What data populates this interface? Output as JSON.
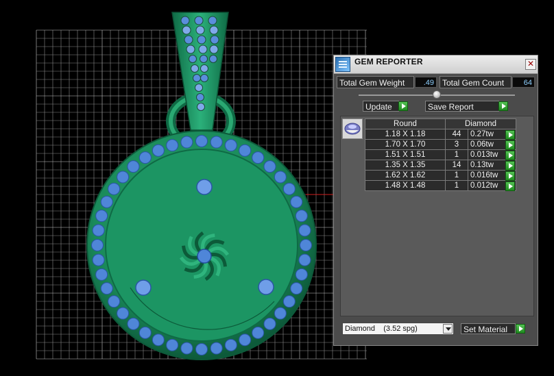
{
  "window": {
    "title": "GEM REPORTER",
    "close_label": "✕"
  },
  "summary": {
    "weight_label": "Total Gem Weight",
    "weight_value": ".49",
    "count_label": "Total Gem Count",
    "count_value": "64"
  },
  "actions": {
    "update_label": "Update",
    "save_label": "Save Report"
  },
  "table": {
    "headers": [
      "Round",
      "",
      "Diamond"
    ],
    "rows": [
      {
        "size": "1.18 X 1.18",
        "count": "44",
        "weight": "0.27tw"
      },
      {
        "size": "1.70 X 1.70",
        "count": "3",
        "weight": "0.06tw"
      },
      {
        "size": "1.51 X 1.51",
        "count": "1",
        "weight": "0.013tw"
      },
      {
        "size": "1.35 X 1.35",
        "count": "14",
        "weight": "0.13tw"
      },
      {
        "size": "1.62 X 1.62",
        "count": "1",
        "weight": "0.016tw"
      },
      {
        "size": "1.48 X 1.48",
        "count": "1",
        "weight": "0.012tw"
      }
    ]
  },
  "material": {
    "selected": "Diamond    (3.52 spg)",
    "set_label": "Set Material"
  },
  "colors": {
    "metal": "#1f8a5c",
    "gem": "#4f86d8",
    "grid": "#9a9a9a",
    "panel": "#4b4b4b"
  }
}
